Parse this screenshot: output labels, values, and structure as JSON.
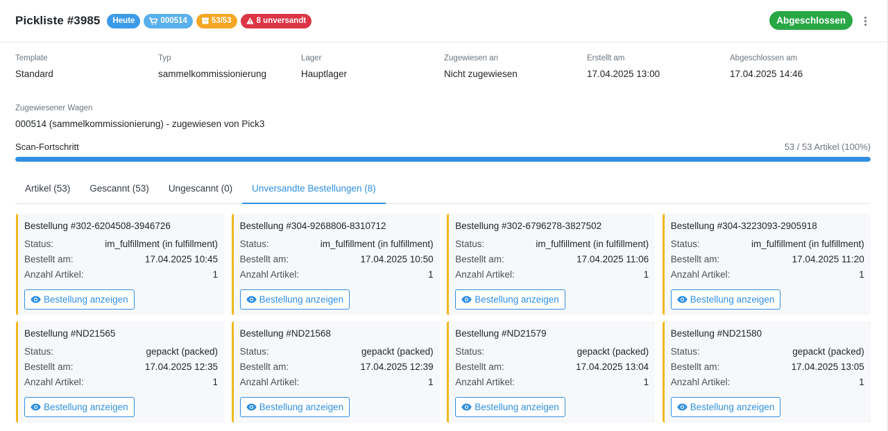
{
  "header": {
    "title": "Pickliste #3985",
    "badges": {
      "today": "Heute",
      "cart": "000514",
      "items": "53/53",
      "unshipped": "8 unversandt"
    },
    "status_button": "Abgeschlossen"
  },
  "info": {
    "template_label": "Template",
    "template_value": "Standard",
    "typ_label": "Typ",
    "typ_value": "sammelkommissionierung",
    "lager_label": "Lager",
    "lager_value": "Hauptlager",
    "zugewiesen_label": "Zugewiesen an",
    "zugewiesen_value": "Nicht zugewiesen",
    "erstellt_label": "Erstellt am",
    "erstellt_value": "17.04.2025 13:00",
    "abgeschlossen_label": "Abgeschlossen am",
    "abgeschlossen_value": "17.04.2025 14:46",
    "wagen_label": "Zugewiesener Wagen",
    "wagen_value": "000514 (sammelkommissionierung) - zugewiesen von Pick3"
  },
  "progress": {
    "label": "Scan-Fortschritt",
    "text": "53 / 53 Artikel (100%)",
    "fraction": 1.0
  },
  "tabs": [
    {
      "label": "Artikel (53)"
    },
    {
      "label": "Gescannt (53)"
    },
    {
      "label": "Ungescannt (0)"
    },
    {
      "label": "Unversandte Bestellungen (8)"
    }
  ],
  "labels": {
    "status": "Status:",
    "bestellt": "Bestellt am:",
    "anzahl": "Anzahl Artikel:",
    "view_button": "Bestellung anzeigen"
  },
  "orders": [
    {
      "title": "Bestellung #302-6204508-3946726",
      "status": "im_fulfillment (in fulfillment)",
      "date": "17.04.2025 10:45",
      "count": "1"
    },
    {
      "title": "Bestellung #304-9268806-8310712",
      "status": "im_fulfillment (in fulfillment)",
      "date": "17.04.2025 10:50",
      "count": "1"
    },
    {
      "title": "Bestellung #302-6796278-3827502",
      "status": "im_fulfillment (in fulfillment)",
      "date": "17.04.2025 11:06",
      "count": "1"
    },
    {
      "title": "Bestellung #304-3223093-2905918",
      "status": "im_fulfillment (in fulfillment)",
      "date": "17.04.2025 11:20",
      "count": "1"
    },
    {
      "title": "Bestellung #ND21565",
      "status": "gepackt (packed)",
      "date": "17.04.2025 12:35",
      "count": "1"
    },
    {
      "title": "Bestellung #ND21568",
      "status": "gepackt (packed)",
      "date": "17.04.2025 12:39",
      "count": "1"
    },
    {
      "title": "Bestellung #ND21579",
      "status": "gepackt (packed)",
      "date": "17.04.2025 13:04",
      "count": "1"
    },
    {
      "title": "Bestellung #ND21580",
      "status": "gepackt (packed)",
      "date": "17.04.2025 13:05",
      "count": "1"
    }
  ],
  "colors": {
    "accent": "#2f8fe0",
    "success": "#28a745",
    "warning": "#f5a623",
    "danger": "#dc3545",
    "card_border": "#f3b71e"
  }
}
